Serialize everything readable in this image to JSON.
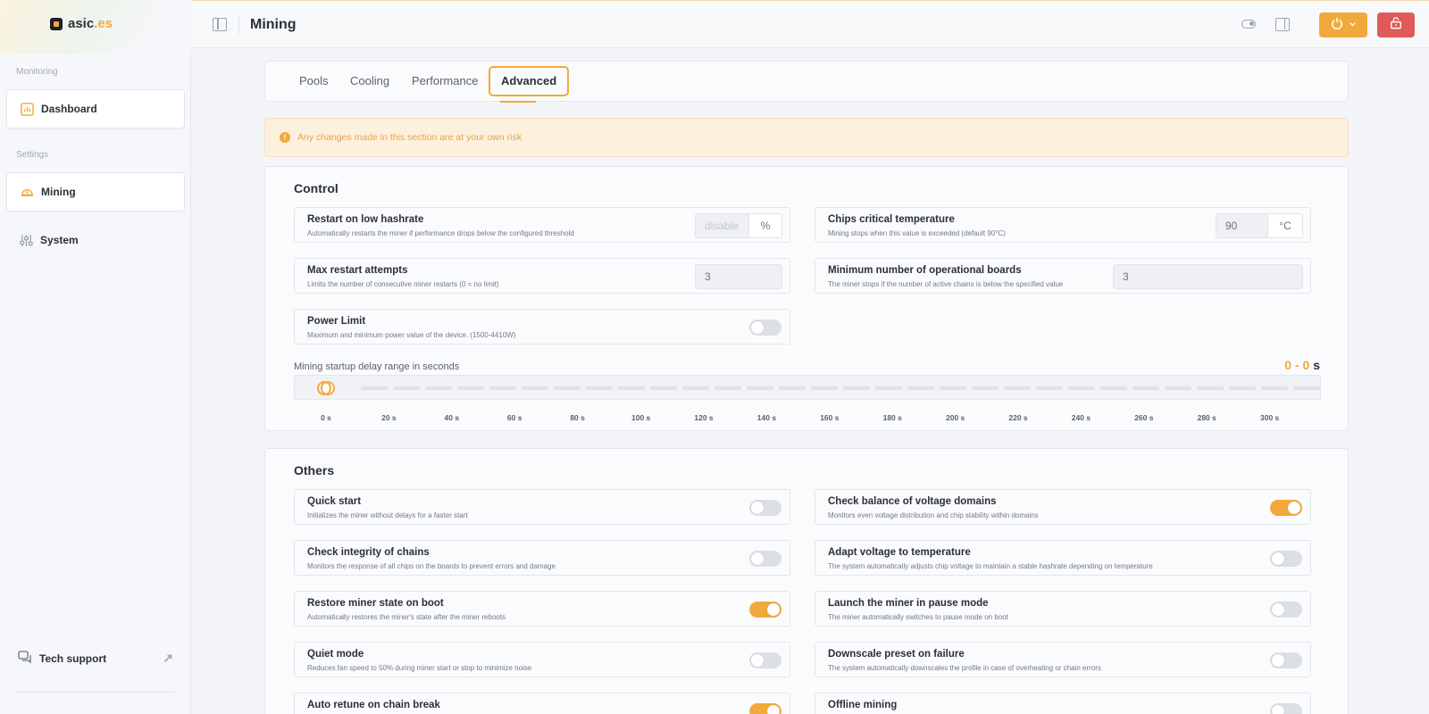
{
  "app": {
    "logo_main": "asic",
    "logo_accent": ".es"
  },
  "sidebar": {
    "monitoring_label": "Monitoring",
    "settings_label": "Settings",
    "items": [
      {
        "label": "Dashboard",
        "icon": "chart-icon"
      },
      {
        "label": "Mining",
        "icon": "helmet-icon"
      },
      {
        "label": "System",
        "icon": "sliders-icon"
      }
    ],
    "support_label": "Tech support"
  },
  "header": {
    "title": "Mining"
  },
  "tabs": [
    "Pools",
    "Cooling",
    "Performance",
    "Advanced"
  ],
  "active_tab": "Advanced",
  "warning": "Any changes made in this section are at your own risk",
  "control": {
    "title": "Control",
    "restart_low_hashrate": {
      "label": "Restart on low hashrate",
      "desc": "Automatically restarts the miner if performance drops below the configured threshold",
      "placeholder": "disable",
      "unit": "%"
    },
    "chips_critical_temp": {
      "label": "Chips critical temperature",
      "desc": "Mining stops when this value is exceeded (default 90°C)",
      "value": "90",
      "unit": "°C"
    },
    "max_restart_attempts": {
      "label": "Max restart attempts",
      "desc": "Limits the number of consecutive miner restarts (0 = no limit)",
      "value": "3"
    },
    "min_operational_boards": {
      "label": "Minimum number of operational boards",
      "desc": "The miner stops if the number of active chains is below the specified value",
      "value": "3"
    },
    "power_limit": {
      "label": "Power Limit",
      "desc": "Maximum and minimum power value of the device. (1500-4410W)",
      "enabled": false
    },
    "startup_delay": {
      "label": "Mining startup delay range in seconds",
      "value_text": "0 - 0",
      "unit": "s",
      "min": 0,
      "max": 0,
      "ticks": [
        "0 s",
        "20 s",
        "40 s",
        "60 s",
        "80 s",
        "100 s",
        "120 s",
        "140 s",
        "160 s",
        "180 s",
        "200 s",
        "220 s",
        "240 s",
        "260 s",
        "280 s",
        "300 s"
      ]
    }
  },
  "others": {
    "title": "Others",
    "items": [
      {
        "label": "Quick start",
        "desc": "Initializes the miner without delays for a faster start",
        "enabled": false
      },
      {
        "label": "Check balance of voltage domains",
        "desc": "Monitors even voltage distribution and chip stability within domains",
        "enabled": true
      },
      {
        "label": "Check integrity of chains",
        "desc": "Monitors the response of all chips on the boards to prevent errors and damage",
        "enabled": false
      },
      {
        "label": "Adapt voltage to temperature",
        "desc": "The system automatically adjusts chip voltage to maintain a stable hashrate depending on temperature",
        "enabled": false
      },
      {
        "label": "Restore miner state on boot",
        "desc": "Automatically restores the miner's state after the miner reboots",
        "enabled": true
      },
      {
        "label": "Launch the miner in pause mode",
        "desc": "The miner automatically switches to pause mode on boot",
        "enabled": false
      },
      {
        "label": "Quiet mode",
        "desc": "Reduces fan speed to 50% during miner start or stop to minimize noise",
        "enabled": false
      },
      {
        "label": "Downscale preset on failure",
        "desc": "The system automatically downscales the profile in case of overheating or chain errors",
        "enabled": false
      },
      {
        "label": "Auto retune on chain break",
        "desc": "",
        "enabled": true
      },
      {
        "label": "Offline mining",
        "desc": "",
        "enabled": false
      }
    ]
  },
  "colors": {
    "accent": "#f2a93b",
    "danger": "#e05a59"
  }
}
